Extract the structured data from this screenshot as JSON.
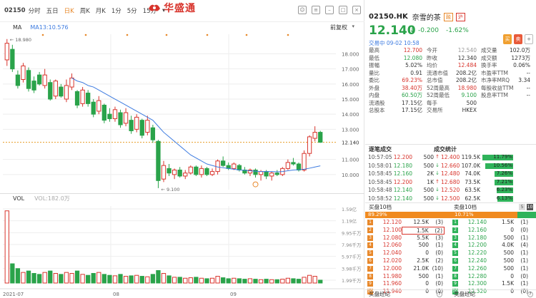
{
  "topbar": {
    "code": "02150",
    "items": [
      "分时",
      "五日",
      "日K",
      "周K",
      "月K",
      "1分",
      "5分",
      "15分"
    ],
    "active_index": 2,
    "brand": "华盛通"
  },
  "chart": {
    "ma_label": "MA",
    "ma13": "MA13:10.576",
    "adjust": "前复权",
    "high_label": "18.980",
    "low_label": "9.100",
    "last_price_label": "12.140",
    "y_ticks": [
      "18.000",
      "17.000",
      "16.000",
      "15.000",
      "14.000",
      "13.000",
      "12.140",
      "11.000",
      "10.000"
    ],
    "x_labels": [
      "2021-07",
      "08",
      "09"
    ]
  },
  "volume": {
    "label": "VOL",
    "value": "VOL:182.0万",
    "y_ticks": [
      "1.59亿",
      "1.19亿",
      "9.95千万",
      "7.96千万",
      "5.97千万",
      "3.98千万",
      "1.99千万"
    ]
  },
  "chart_data": {
    "type": "candlestick",
    "series_ma13": "MA13",
    "candles": [
      {
        "o": 17.6,
        "c": 18.7,
        "h": 18.98,
        "l": 17.2
      },
      {
        "o": 18.3,
        "c": 17.0,
        "h": 18.6,
        "l": 16.8
      },
      {
        "o": 16.6,
        "c": 15.9,
        "h": 16.9,
        "l": 15.7
      },
      {
        "o": 16.3,
        "c": 17.2,
        "h": 17.4,
        "l": 16.1
      },
      {
        "o": 16.9,
        "c": 15.7,
        "h": 17.1,
        "l": 15.5
      },
      {
        "o": 16.2,
        "c": 15.6,
        "h": 16.5,
        "l": 15.4
      },
      {
        "o": 16.6,
        "c": 16.0,
        "h": 16.8,
        "l": 15.9
      },
      {
        "o": 15.9,
        "c": 16.6,
        "h": 17.0,
        "l": 15.7
      },
      {
        "o": 16.1,
        "c": 15.0,
        "h": 16.3,
        "l": 14.9
      },
      {
        "o": 15.2,
        "c": 16.2,
        "h": 16.3,
        "l": 15.0
      },
      {
        "o": 15.8,
        "c": 15.2,
        "h": 16.0,
        "l": 15.1
      },
      {
        "o": 15.0,
        "c": 15.9,
        "h": 16.3,
        "l": 14.8
      },
      {
        "o": 15.8,
        "c": 16.4,
        "h": 16.7,
        "l": 15.6
      },
      {
        "o": 15.5,
        "c": 14.6,
        "h": 15.6,
        "l": 14.4
      },
      {
        "o": 14.7,
        "c": 15.6,
        "h": 15.8,
        "l": 14.5
      },
      {
        "o": 15.4,
        "c": 14.7,
        "h": 15.6,
        "l": 14.5
      },
      {
        "o": 14.8,
        "c": 14.0,
        "h": 15.0,
        "l": 13.8
      },
      {
        "o": 14.2,
        "c": 14.9,
        "h": 15.2,
        "l": 14.0
      },
      {
        "o": 14.6,
        "c": 13.6,
        "h": 14.7,
        "l": 13.4
      },
      {
        "o": 14.0,
        "c": 13.7,
        "h": 14.4,
        "l": 13.5
      },
      {
        "o": 13.7,
        "c": 14.3,
        "h": 14.5,
        "l": 13.5
      },
      {
        "o": 14.1,
        "c": 13.3,
        "h": 14.3,
        "l": 13.1
      },
      {
        "o": 13.4,
        "c": 14.1,
        "h": 14.4,
        "l": 13.2
      },
      {
        "o": 13.6,
        "c": 12.9,
        "h": 13.9,
        "l": 12.7
      },
      {
        "o": 13.0,
        "c": 13.8,
        "h": 14.0,
        "l": 12.8
      },
      {
        "o": 13.6,
        "c": 12.6,
        "h": 13.7,
        "l": 12.4
      },
      {
        "o": 12.8,
        "c": 13.6,
        "h": 13.9,
        "l": 12.6
      },
      {
        "o": 13.1,
        "c": 12.3,
        "h": 13.3,
        "l": 12.1
      },
      {
        "o": 12.2,
        "c": 9.6,
        "h": 12.3,
        "l": 9.1
      },
      {
        "o": 9.7,
        "c": 10.6,
        "h": 10.9,
        "l": 9.5
      },
      {
        "o": 10.4,
        "c": 10.1,
        "h": 10.7,
        "l": 9.9
      },
      {
        "o": 10.0,
        "c": 10.3,
        "h": 10.4,
        "l": 9.7
      },
      {
        "o": 10.3,
        "c": 9.9,
        "h": 10.5,
        "l": 9.8
      },
      {
        "o": 9.9,
        "c": 10.1,
        "h": 10.3,
        "l": 9.7
      },
      {
        "o": 10.1,
        "c": 10.5,
        "h": 10.6,
        "l": 10.0
      },
      {
        "o": 10.5,
        "c": 10.0,
        "h": 10.6,
        "l": 9.9
      },
      {
        "o": 10.0,
        "c": 10.4,
        "h": 10.6,
        "l": 9.8
      },
      {
        "o": 10.4,
        "c": 10.0,
        "h": 10.5,
        "l": 9.9
      },
      {
        "o": 10.0,
        "c": 10.2,
        "h": 10.4,
        "l": 9.9
      },
      {
        "o": 10.2,
        "c": 10.9,
        "h": 11.0,
        "l": 10.0
      },
      {
        "o": 10.9,
        "c": 10.6,
        "h": 11.2,
        "l": 10.5
      },
      {
        "o": 10.6,
        "c": 10.4,
        "h": 10.8,
        "l": 10.3
      },
      {
        "o": 10.4,
        "c": 10.7,
        "h": 10.8,
        "l": 10.3
      },
      {
        "o": 10.6,
        "c": 10.3,
        "h": 10.7,
        "l": 10.2
      },
      {
        "o": 10.3,
        "c": 10.1,
        "h": 10.5,
        "l": 10.0
      },
      {
        "o": 10.1,
        "c": 10.3,
        "h": 10.4,
        "l": 9.9
      },
      {
        "o": 10.3,
        "c": 10.0,
        "h": 10.4,
        "l": 9.8
      },
      {
        "o": 10.0,
        "c": 10.2,
        "h": 10.3,
        "l": 9.6
      },
      {
        "o": 10.2,
        "c": 9.9,
        "h": 10.3,
        "l": 9.7
      },
      {
        "o": 9.9,
        "c": 10.1,
        "h": 10.2,
        "l": 9.6
      },
      {
        "o": 10.1,
        "c": 10.0,
        "h": 10.3,
        "l": 9.9
      },
      {
        "o": 10.0,
        "c": 10.4,
        "h": 10.5,
        "l": 9.9
      },
      {
        "o": 10.4,
        "c": 10.8,
        "h": 11.0,
        "l": 10.3
      },
      {
        "o": 10.8,
        "c": 10.7,
        "h": 11.1,
        "l": 10.6
      },
      {
        "o": 10.7,
        "c": 10.3,
        "h": 10.8,
        "l": 10.2
      },
      {
        "o": 10.3,
        "c": 11.4,
        "h": 11.6,
        "l": 10.2
      },
      {
        "o": 11.4,
        "c": 12.5,
        "h": 12.6,
        "l": 11.2
      },
      {
        "o": 12.4,
        "c": 12.8,
        "h": 13.2,
        "l": 12.2
      },
      {
        "o": 12.8,
        "c": 12.14,
        "h": 12.9,
        "l": 12.1
      }
    ],
    "ma13": [
      null,
      null,
      null,
      null,
      null,
      null,
      null,
      null,
      null,
      null,
      null,
      null,
      16.4,
      16.2,
      16.1,
      15.9,
      15.8,
      15.6,
      15.4,
      15.2,
      15.0,
      14.8,
      14.6,
      14.4,
      14.2,
      14.0,
      13.8,
      13.6,
      13.2,
      12.8,
      12.5,
      12.2,
      11.9,
      11.6,
      11.3,
      11.1,
      10.9,
      10.7,
      10.6,
      10.5,
      10.45,
      10.4,
      10.35,
      10.3,
      10.28,
      10.25,
      10.22,
      10.2,
      10.2,
      10.2,
      10.18,
      10.2,
      10.25,
      10.3,
      10.32,
      10.35,
      10.42,
      10.5,
      10.576
    ],
    "volumes": [
      150,
      40,
      30,
      22,
      25,
      20,
      18,
      22,
      25,
      20,
      18,
      22,
      20,
      25,
      18,
      16,
      20,
      22,
      18,
      16,
      15,
      18,
      14,
      15,
      16,
      14,
      13,
      18,
      26,
      20,
      15,
      12,
      12,
      10,
      11,
      12,
      10,
      9,
      10,
      14,
      11,
      9,
      10,
      9,
      8,
      9,
      8,
      7,
      8,
      7,
      7,
      8,
      10,
      9,
      8,
      12,
      16,
      14,
      6
    ],
    "ylim": [
      9.0,
      19.3
    ],
    "vol_max": 160
  },
  "quote": {
    "code": "02150.HK",
    "name": "奈雪的茶",
    "badge1": "融",
    "badge2": "沪",
    "price": "12.140",
    "arrow": "↓",
    "change": "-0.200",
    "change_pct": "-1.62%",
    "time": "交易中 09-02 10:58",
    "btn1": "买",
    "btn2": "卖",
    "btn3": "+"
  },
  "stats": [
    [
      [
        "最高",
        "12.700",
        "red"
      ],
      [
        "今开",
        "12.540",
        "gry"
      ],
      [
        "成交量",
        "102.0万",
        ""
      ]
    ],
    [
      [
        "最低",
        "12.080",
        "grn"
      ],
      [
        "昨收",
        "12.340",
        ""
      ],
      [
        "成交额",
        "1273万",
        ""
      ]
    ],
    [
      [
        "振幅",
        "5.02%",
        ""
      ],
      [
        "均价",
        "12.484",
        "red"
      ],
      [
        "换手率",
        "0.06%",
        ""
      ]
    ],
    [
      [
        "量比",
        "0.91",
        ""
      ],
      [
        "流通市值",
        "208.2亿",
        ""
      ],
      [
        "市盈率TTM",
        "--",
        ""
      ]
    ],
    [
      [
        "委比",
        "69.23%",
        "red"
      ],
      [
        "总市值",
        "208.2亿",
        ""
      ],
      [
        "市净率MRQ",
        "3.34",
        ""
      ]
    ],
    [
      [
        "外盘",
        "38.40万",
        "red"
      ],
      [
        "52周最高",
        "18.980",
        "red"
      ],
      [
        "每股收益TTM",
        "--",
        ""
      ]
    ],
    [
      [
        "内盘",
        "60.50万",
        "grn"
      ],
      [
        "52周最低",
        "9.100",
        "grn"
      ],
      [
        "股息率TTM",
        "--",
        ""
      ]
    ],
    [
      [
        "流通股",
        "17.15亿",
        ""
      ],
      [
        "每手",
        "500",
        ""
      ],
      [
        "",
        "",
        ""
      ]
    ],
    [
      [
        "总股本",
        "17.15亿",
        ""
      ],
      [
        "交易所",
        "HKEX",
        ""
      ],
      [
        "",
        "",
        ""
      ]
    ]
  ],
  "ticks": {
    "tab1": "逐笔成交",
    "tab2": "成交统计",
    "rows": [
      {
        "time": "10:57:05",
        "price": "12.200",
        "vol": "500",
        "dir": "↑",
        "b_price": "12.400",
        "b_vol": "119.5K",
        "pct": "11.79%",
        "fill": 0.98
      },
      {
        "time": "10:58:01",
        "price": "12.180",
        "vol": "500",
        "dir": "↓",
        "b_price": "12.660",
        "b_vol": "107.0K",
        "pct": "10.56%",
        "fill": 0.88
      },
      {
        "time": "10:58:45",
        "price": "12.160",
        "vol": "2K",
        "dir": "↓",
        "b_price": "12.480",
        "b_vol": "74.0K",
        "pct": "7.26%",
        "fill": 0.6
      },
      {
        "time": "10:58:45",
        "price": "12.200",
        "vol": "1K",
        "dir": "↑",
        "b_price": "12.680",
        "b_vol": "73.5K",
        "pct": "7.21%",
        "fill": 0.6
      },
      {
        "time": "10:58:48",
        "price": "12.140",
        "vol": "500",
        "dir": "↓",
        "b_price": "12.520",
        "b_vol": "63.5K",
        "pct": "6.23%",
        "fill": 0.52
      },
      {
        "time": "10:58:52",
        "price": "12.140",
        "vol": "500",
        "dir": "↓",
        "b_price": "12.500",
        "b_vol": "62.5K",
        "pct": "6.13%",
        "fill": 0.51
      }
    ]
  },
  "orderbook": {
    "bid_title": "买盘10档",
    "ask_title": "卖盘10档",
    "lv_btns": [
      "5",
      "10"
    ],
    "bid_pct": "89.29%",
    "ask_pct": "10.71%",
    "bid_ratio": 0.8929,
    "bids": [
      {
        "lv": "1",
        "price": "12.120",
        "vol": "12.5K",
        "n": "(3)"
      },
      {
        "lv": "2",
        "price": "12.100",
        "vol": "1.5K",
        "n": "(2)"
      },
      {
        "lv": "3",
        "price": "12.080",
        "vol": "5.5K",
        "n": "(3)"
      },
      {
        "lv": "4",
        "price": "12.060",
        "vol": "500",
        "n": "(1)"
      },
      {
        "lv": "5",
        "price": "12.040",
        "vol": "0",
        "n": "(0)"
      },
      {
        "lv": "6",
        "price": "12.020",
        "vol": "2.5K",
        "n": "(2)"
      },
      {
        "lv": "7",
        "price": "12.000",
        "vol": "21.0K",
        "n": "(10)"
      },
      {
        "lv": "8",
        "price": "11.980",
        "vol": "500",
        "n": "(1)"
      },
      {
        "lv": "9",
        "price": "11.960",
        "vol": "0",
        "n": "(0)"
      },
      {
        "lv": "10",
        "price": "11.940",
        "vol": "0",
        "n": "(0)"
      }
    ],
    "asks": [
      {
        "lv": "1",
        "price": "12.140",
        "vol": "1.5K",
        "n": "(1)"
      },
      {
        "lv": "2",
        "price": "12.160",
        "vol": "0",
        "n": "(0)"
      },
      {
        "lv": "3",
        "price": "12.180",
        "vol": "500",
        "n": "(1)"
      },
      {
        "lv": "4",
        "price": "12.200",
        "vol": "4.0K",
        "n": "(4)"
      },
      {
        "lv": "5",
        "price": "12.220",
        "vol": "500",
        "n": "(1)"
      },
      {
        "lv": "6",
        "price": "12.240",
        "vol": "500",
        "n": "(1)"
      },
      {
        "lv": "7",
        "price": "12.260",
        "vol": "500",
        "n": "(1)"
      },
      {
        "lv": "8",
        "price": "12.280",
        "vol": "0",
        "n": "(0)"
      },
      {
        "lv": "9",
        "price": "12.300",
        "vol": "1.5K",
        "n": "(1)"
      },
      {
        "lv": "10",
        "price": "12.320",
        "vol": "0",
        "n": "(0)"
      }
    ]
  },
  "footer": {
    "bid": "买盘经纪",
    "ask": "卖盘经纪",
    "r1": "?",
    "r2": "?"
  },
  "colors": {
    "up": "#d8342c",
    "down": "#2aa34a",
    "ma": "#3d7be0",
    "accent": "#e8882a"
  }
}
